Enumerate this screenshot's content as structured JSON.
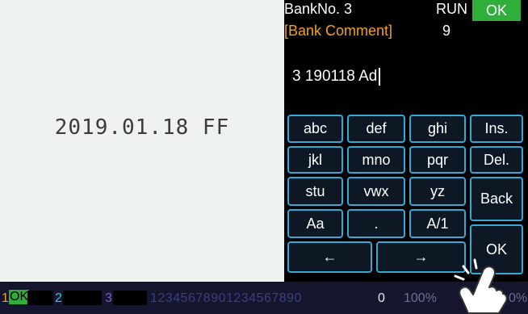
{
  "left_panel": {
    "date_text": "2019.01.18 FF"
  },
  "header": {
    "bank_no": "BankNo. 3",
    "run": "RUN",
    "ok_badge": "OK",
    "comment": "[Bank Comment]",
    "count": "9"
  },
  "entry": {
    "value": "3  190118 Ad"
  },
  "keys": {
    "abc": "abc",
    "def": "def",
    "ghi": "ghi",
    "ins": "Ins.",
    "jkl": "jkl",
    "mno": "mno",
    "pqr": "pqr",
    "del": "Del.",
    "stu": "stu",
    "vwx": "vwx",
    "yz": "yz",
    "back": "Back",
    "aa": "Aa",
    "dot": ".",
    "a1": "A/1",
    "left": "←",
    "right": "→",
    "ok": "OK"
  },
  "status_bar": {
    "ch1_num": "1",
    "ch1_state": "OK",
    "ch2_num": "2",
    "ch3_num": "3",
    "digits": "12345678901234567890",
    "zero": "0",
    "percent": "100%",
    "percent_right": "0%"
  },
  "colors": {
    "accent_green": "#2fae3a",
    "comment_orange": "#f0a21a",
    "key_border": "#35a8d6"
  }
}
